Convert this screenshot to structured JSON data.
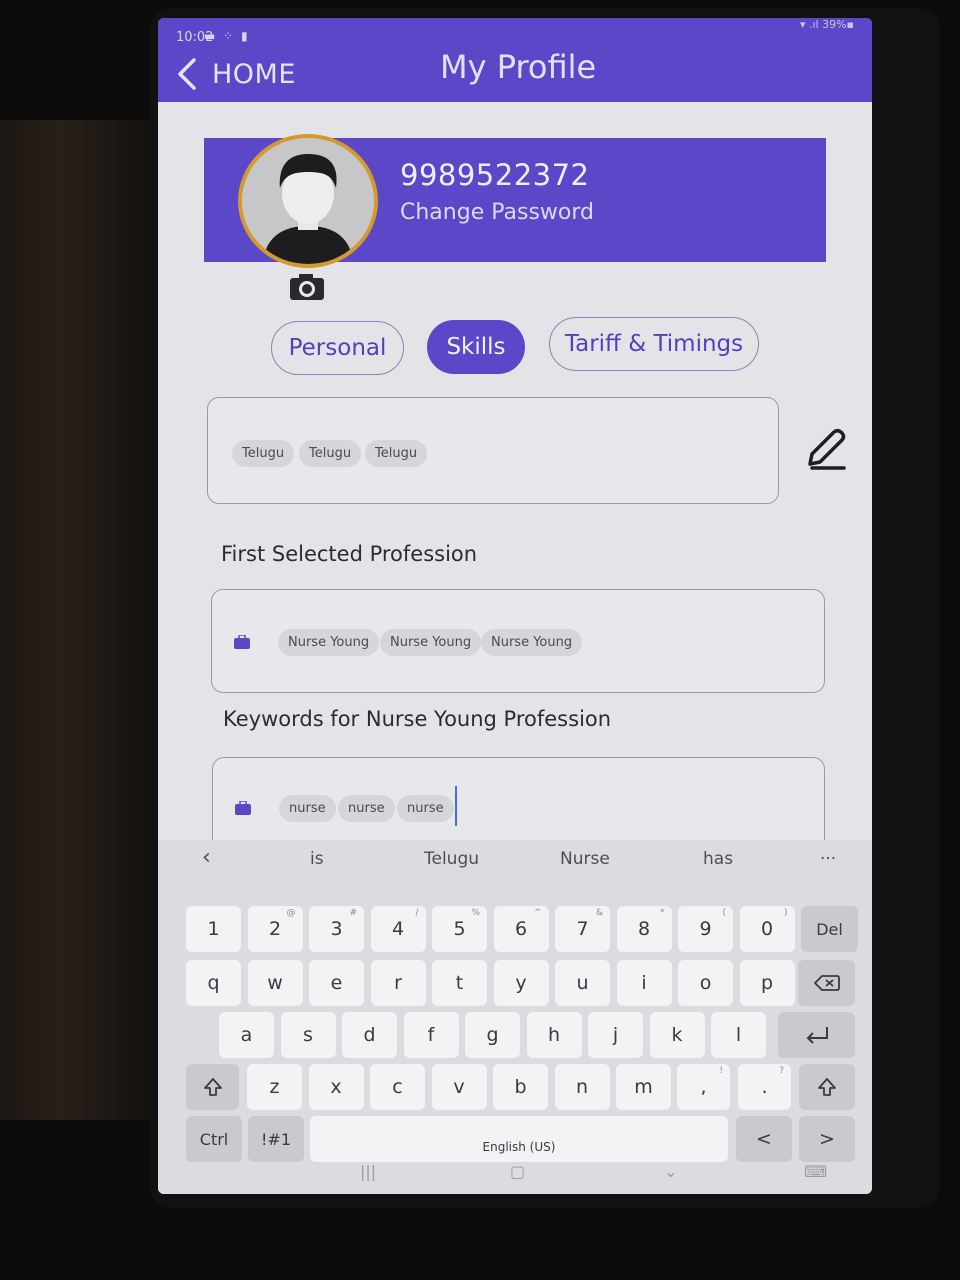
{
  "status_bar": {
    "time": "10:02",
    "left_icons": "▬ ⁘ ▮",
    "right_text": "▾ .ıl 39%▪"
  },
  "header": {
    "back_label": "HOME",
    "title": "My Profile"
  },
  "profile": {
    "phone": "9989522372",
    "change_password": "Change Password"
  },
  "tabs": [
    {
      "label": "Personal",
      "active": false
    },
    {
      "label": "Skills",
      "active": true
    },
    {
      "label": "Tariff & Timings",
      "active": false
    }
  ],
  "languages": {
    "chips": [
      "Telugu",
      "Telugu",
      "Telugu"
    ]
  },
  "professions": {
    "label": "First Selected Profession",
    "chips": [
      "Nurse Young",
      "Nurse Young",
      "Nurse Young"
    ]
  },
  "keywords": {
    "label": "Keywords for Nurse Young Profession",
    "chips": [
      "nurse",
      "nurse",
      "nurse"
    ]
  },
  "keyboard": {
    "suggestions": [
      "is",
      "Telugu",
      "Nurse",
      "has"
    ],
    "more": "···",
    "row_numbers": [
      {
        "k": "1",
        "h": ""
      },
      {
        "k": "2",
        "h": "@"
      },
      {
        "k": "3",
        "h": "#"
      },
      {
        "k": "4",
        "h": "/"
      },
      {
        "k": "5",
        "h": "%"
      },
      {
        "k": "6",
        "h": "^"
      },
      {
        "k": "7",
        "h": "&"
      },
      {
        "k": "8",
        "h": "*"
      },
      {
        "k": "9",
        "h": "("
      },
      {
        "k": "0",
        "h": ")"
      },
      {
        "k": "Del",
        "h": ""
      }
    ],
    "row_q": [
      "q",
      "w",
      "e",
      "r",
      "t",
      "y",
      "u",
      "i",
      "o",
      "p"
    ],
    "row_a": [
      "a",
      "s",
      "d",
      "f",
      "g",
      "h",
      "j",
      "k",
      "l"
    ],
    "row_z": [
      "z",
      "x",
      "c",
      "v",
      "b",
      "n",
      "m"
    ],
    "punct1": ",",
    "punct1_hint": "!",
    "punct2": ".",
    "punct2_hint": "?",
    "ctrl": "Ctrl",
    "symbols": "!#1",
    "space": "English (US)",
    "left_arrow": "<",
    "right_arrow": ">"
  },
  "colors": {
    "accent": "#5b48c9",
    "avatar_ring": "#d49a2a",
    "caret": "#4a6bd8"
  }
}
